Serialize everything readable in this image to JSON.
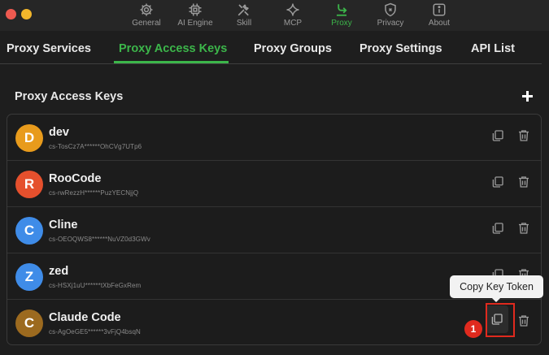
{
  "topnav": {
    "items": [
      {
        "label": "General",
        "icon": "gear-icon"
      },
      {
        "label": "AI Engine",
        "icon": "chip-icon"
      },
      {
        "label": "Skill",
        "icon": "tools-icon"
      },
      {
        "label": "MCP",
        "icon": "sparkle-icon"
      },
      {
        "label": "Proxy",
        "icon": "proxy-icon",
        "active": true
      },
      {
        "label": "Privacy",
        "icon": "shield-icon"
      },
      {
        "label": "About",
        "icon": "info-icon"
      }
    ]
  },
  "tabs": {
    "items": [
      {
        "label": "Proxy Services"
      },
      {
        "label": "Proxy Access Keys",
        "active": true
      },
      {
        "label": "Proxy Groups"
      },
      {
        "label": "Proxy Settings"
      },
      {
        "label": "API List"
      }
    ]
  },
  "section": {
    "title": "Proxy Access Keys",
    "add_icon": "plus-icon"
  },
  "keys": [
    {
      "initial": "D",
      "name": "dev",
      "key": "cs-TosCz7A******OhCVg7UTp6",
      "color": "#e89b1c"
    },
    {
      "initial": "R",
      "name": "RooCode",
      "key": "cs-rwRezzH******PuzYECNjjQ",
      "color": "#e5502d"
    },
    {
      "initial": "C",
      "name": "Cline",
      "key": "cs-OEOQWS8******NuVZ0d3GWv",
      "color": "#3f8ce8"
    },
    {
      "initial": "Z",
      "name": "zed",
      "key": "cs-HSXj1uU******tXbFeGxRem",
      "color": "#3f8ce8"
    },
    {
      "initial": "C",
      "name": "Claude Code",
      "key": "cs-AgOeGE5******3vFjQ4bsqN",
      "color": "#9c6a1f"
    }
  ],
  "tooltip": {
    "text": "Copy Key Token"
  },
  "annotation": {
    "step": "1"
  },
  "colors": {
    "accent": "#3cb64a",
    "background": "#1e1e1e",
    "annotation": "#e02a1e"
  }
}
